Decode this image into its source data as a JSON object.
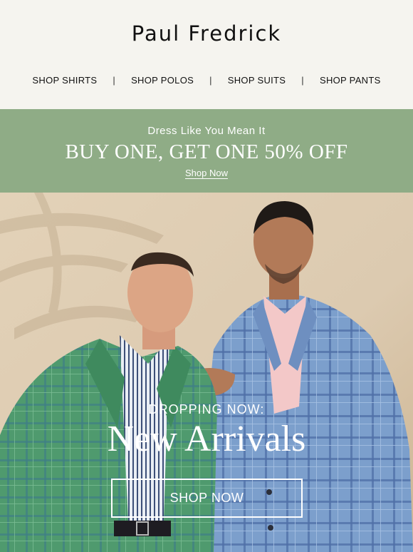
{
  "header": {
    "brand": "Paul Fredrick",
    "nav": [
      {
        "label": "SHOP SHIRTS"
      },
      {
        "label": "SHOP POLOS"
      },
      {
        "label": "SHOP SUITS"
      },
      {
        "label": "SHOP PANTS"
      }
    ],
    "separator": "|"
  },
  "promo": {
    "eyebrow": "Dress Like You Mean It",
    "headline": "BUY ONE, GET ONE 50% OFF",
    "link": "Shop Now",
    "background": "#8fac86"
  },
  "hero": {
    "eyebrow": "DROPPING NOW:",
    "title": "New Arrivals",
    "button": "SHOP NOW",
    "image": "two-men-in-plaid-sport-coats-photo"
  }
}
